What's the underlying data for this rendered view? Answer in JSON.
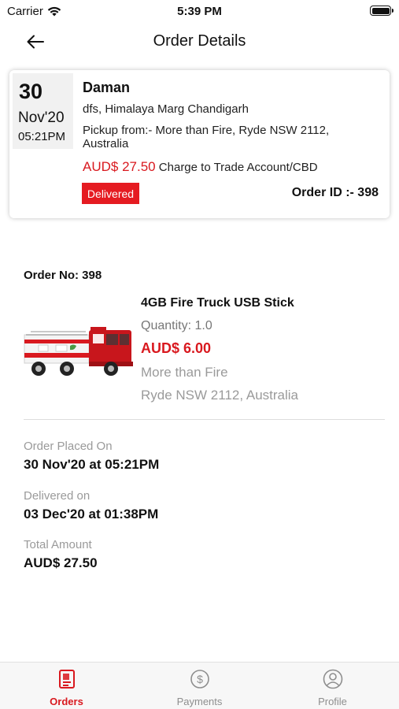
{
  "status_bar": {
    "carrier": "Carrier",
    "time": "5:39 PM"
  },
  "nav": {
    "title": "Order Details"
  },
  "order_card": {
    "day": "30",
    "month": "Nov'20",
    "time": "05:21PM",
    "customer_name": "Daman",
    "address": "dfs, Himalaya Marg Chandigarh",
    "pickup": "Pickup from:- More than Fire, Ryde NSW 2112, Australia",
    "amount": "AUD$ 27.50",
    "charge_note": "Charge to Trade Account/CBD",
    "status": "Delivered",
    "order_id": "Order ID :- 398"
  },
  "order_no": "Order No: 398",
  "item": {
    "name": "4GB Fire Truck USB Stick",
    "quantity": "Quantity: 1.0",
    "price": "AUD$ 6.00",
    "seller": "More than Fire",
    "seller_address": "Ryde NSW 2112, Australia"
  },
  "summary": {
    "placed_label": "Order Placed On",
    "placed_value": "30 Nov'20 at 05:21PM",
    "delivered_label": "Delivered on",
    "delivered_value": "03 Dec'20 at 01:38PM",
    "total_label": "Total Amount",
    "total_value": "AUD$ 27.50"
  },
  "tabs": [
    {
      "label": "Orders",
      "icon": "orders-icon",
      "active": true
    },
    {
      "label": "Payments",
      "icon": "payments-icon",
      "active": false
    },
    {
      "label": "Profile",
      "icon": "profile-icon",
      "active": false
    }
  ],
  "colors": {
    "accent": "#d9191f",
    "badge": "#e51b21",
    "muted": "#9a9a9a"
  }
}
